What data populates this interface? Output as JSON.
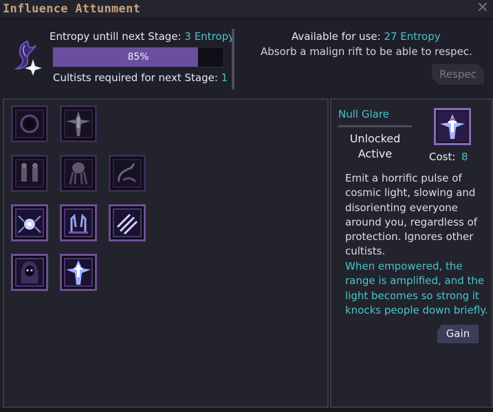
{
  "window": {
    "title": "Influence Attunment",
    "close_icon": "close-x-icon"
  },
  "header": {
    "emblem_icon": "entropy-rune-icon",
    "entropy_label": "Entropy untill next Stage:",
    "entropy_value": "3 Entropy",
    "progress_percent": 85,
    "progress_text": "85%",
    "cultists_label": "Cultists required for next Stage:",
    "cultists_value": "1",
    "available_label": "Available for use:",
    "available_value": "27 Entropy",
    "respec_hint": "Absorb a malign rift to be able to respec.",
    "respec_button": "Respec"
  },
  "skills": [
    {
      "id": "void-ring",
      "icon": "void-ring-icon",
      "unlocked": false
    },
    {
      "id": "null-glare",
      "icon": "radiant-figure-icon",
      "unlocked": false
    },
    {
      "id": "twin-figures",
      "icon": "twin-figures-icon",
      "unlocked": false
    },
    {
      "id": "tentacle-horror",
      "icon": "tentacle-horror-icon",
      "unlocked": false
    },
    {
      "id": "wraith-claw",
      "icon": "wraith-claw-icon",
      "unlocked": false
    },
    {
      "id": "spider-eye",
      "icon": "spider-eye-icon",
      "unlocked": true
    },
    {
      "id": "grasping-hands",
      "icon": "grasping-hands-icon",
      "unlocked": true
    },
    {
      "id": "slashes",
      "icon": "slash-marks-icon",
      "unlocked": true
    },
    {
      "id": "hooded-face",
      "icon": "hooded-face-icon",
      "unlocked": true
    },
    {
      "id": "radiant-figure",
      "icon": "radiant-figure-icon",
      "unlocked": true
    }
  ],
  "detail": {
    "name": "Null Glare",
    "icon": "radiant-figure-icon",
    "status_unlocked": "Unlocked",
    "status_active": "Active",
    "cost_label": "Cost:",
    "cost_value": "8",
    "description": "Emit a horrific pulse of cosmic light, slowing and disorienting everyone around you, regardless of protection. Ignores other cultists.",
    "empowered": "When empowered, the range is amplified, and the light becomes so strong it knocks people down briefly.",
    "gain_button": "Gain"
  },
  "colors": {
    "title": "#c9a27a",
    "accent": "#4fc3c9",
    "progress_fill": "#6a4fa0",
    "skill_border": "#6d4f95",
    "panel_bg": "#22232d"
  }
}
